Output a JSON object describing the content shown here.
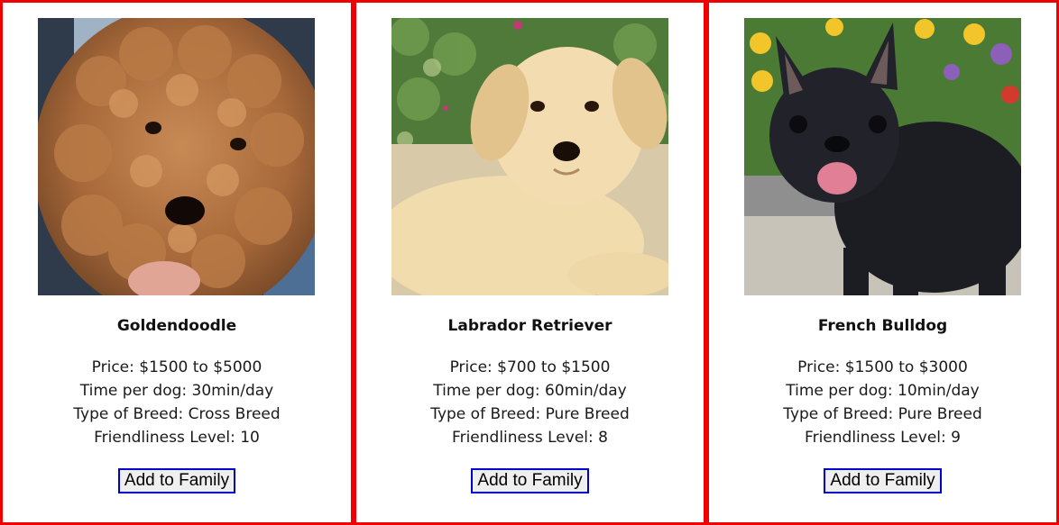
{
  "dogs": [
    {
      "name": "Goldendoodle",
      "image_icon": "goldendoodle-puppy-photo",
      "price": "Price: $1500 to $5000",
      "time": "Time per dog: 30min/day",
      "breed_type": "Type of Breed: Cross Breed",
      "friendliness": "Friendliness Level: 10",
      "button_label": "Add to Family"
    },
    {
      "name": "Labrador Retriever",
      "image_icon": "labrador-puppy-photo",
      "price": "Price: $700 to $1500",
      "time": "Time per dog: 60min/day",
      "breed_type": "Type of Breed: Pure Breed",
      "friendliness": "Friendliness Level: 8",
      "button_label": "Add to Family"
    },
    {
      "name": "French Bulldog",
      "image_icon": "french-bulldog-puppy-photo",
      "price": "Price: $1500 to $3000",
      "time": "Time per dog: 10min/day",
      "breed_type": "Type of Breed: Pure Breed",
      "friendliness": "Friendliness Level: 9",
      "button_label": "Add to Family"
    }
  ],
  "colors": {
    "card_border": "#f00000",
    "button_border": "#0000cc",
    "button_background": "#efefef"
  }
}
